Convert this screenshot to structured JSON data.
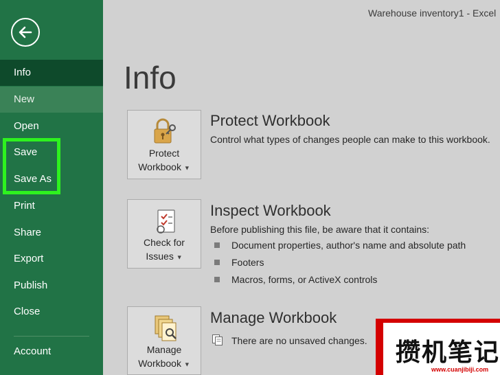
{
  "window": {
    "doc_title": "Warehouse inventory1  -  Excel"
  },
  "sidebar": {
    "back_icon": "back-arrow-icon",
    "items": [
      {
        "label": "Info"
      },
      {
        "label": "New"
      },
      {
        "label": "Open"
      },
      {
        "label": "Save"
      },
      {
        "label": "Save As"
      },
      {
        "label": "Print"
      },
      {
        "label": "Share"
      },
      {
        "label": "Export"
      },
      {
        "label": "Publish"
      },
      {
        "label": "Close"
      },
      {
        "label": "Account"
      }
    ],
    "accent_color": "#217346",
    "highlight_color": "#2ef21f"
  },
  "main": {
    "title": "Info",
    "sections": [
      {
        "tile_label_1": "Protect",
        "tile_label_2": "Workbook",
        "icon": "lock-key-icon",
        "title": "Protect Workbook",
        "description": "Control what types of changes people can make to this workbook."
      },
      {
        "tile_label_1": "Check for",
        "tile_label_2": "Issues",
        "icon": "checklist-icon",
        "title": "Inspect Workbook",
        "description": "Before publishing this file, be aware that it contains:",
        "bullets": [
          "Document properties, author's name and absolute path",
          "Footers",
          "Macros, forms, or ActiveX controls"
        ]
      },
      {
        "tile_label_1": "Manage",
        "tile_label_2": "Workbook",
        "icon": "manage-versions-icon",
        "title": "Manage Workbook",
        "note": "There are no unsaved changes."
      }
    ]
  },
  "watermark": {
    "text": "攒机笔记",
    "url": "www.cuanjibiji.com"
  }
}
